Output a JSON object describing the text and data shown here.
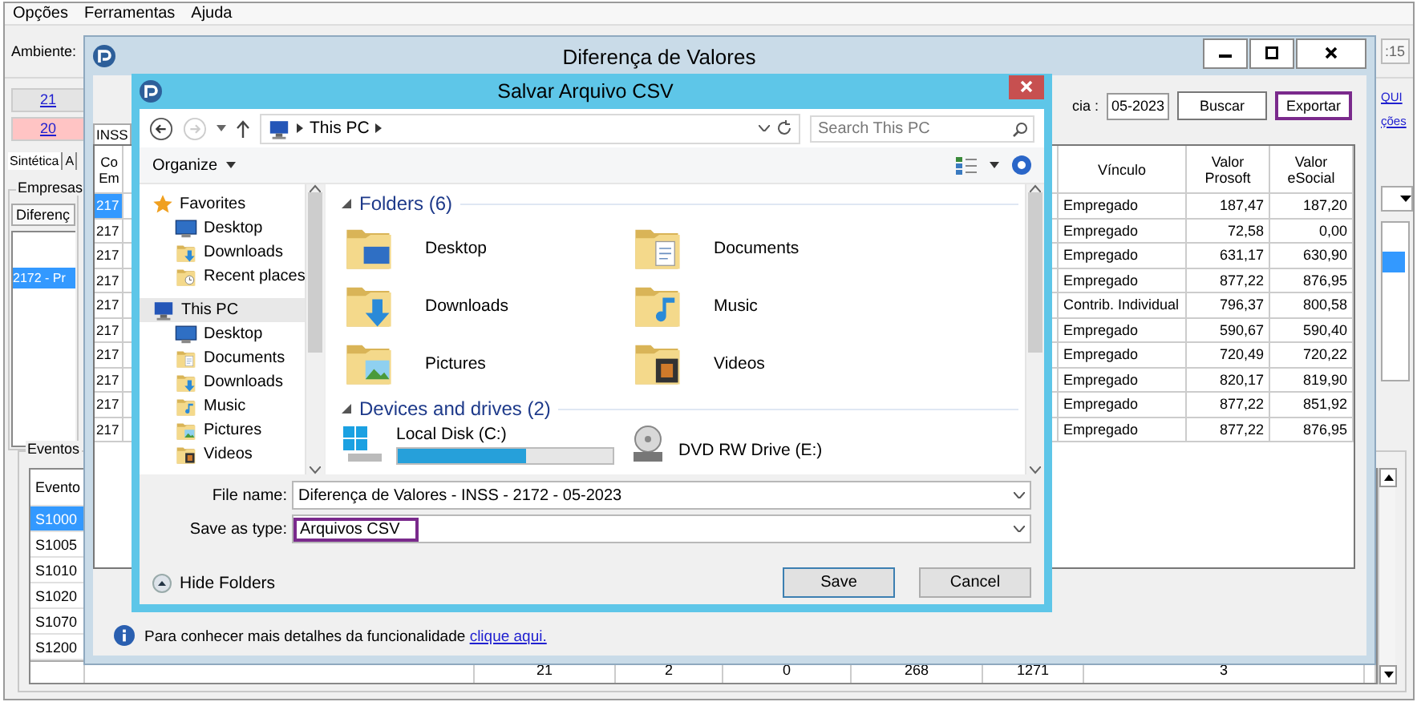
{
  "menu": [
    {
      "label": "Opções"
    },
    {
      "label": "Ferramentas"
    },
    {
      "label": "Ajuda"
    }
  ],
  "main": {
    "environment_label": "Ambiente:",
    "clock_fragment": ":15",
    "counters": [
      {
        "text": "21",
        "color": "#e4e4e4"
      },
      {
        "text": "20",
        "color": "#ffc4c4"
      }
    ],
    "links": [
      "QUI",
      "ções"
    ],
    "tabs": [
      {
        "label": "Sintética",
        "selected": true
      },
      {
        "label": "A",
        "selected": false
      }
    ],
    "companies": {
      "title": "Empresas",
      "dropdown": "Diferenç",
      "items": [
        {
          "label": "2172 - Pr",
          "selected": true
        }
      ]
    },
    "events": {
      "title": "Eventos",
      "header": "Evento",
      "rows": [
        {
          "code": "S1000",
          "selected": true
        },
        {
          "code": "S1005",
          "selected": false
        },
        {
          "code": "S1010",
          "selected": false
        },
        {
          "code": "S1020",
          "selected": false
        },
        {
          "code": "S1070",
          "selected": false
        },
        {
          "code": "S1200",
          "selected": false
        }
      ],
      "totals": [
        "21",
        "2",
        "0",
        "268",
        "1271",
        "3"
      ]
    }
  },
  "diff_window": {
    "title": "Diferença de Valores",
    "period_label": "cia :",
    "period": "05-2023",
    "buttons": [
      {
        "label": "Buscar",
        "highlighted": false
      },
      {
        "label": "Exportar",
        "highlighted": true
      }
    ],
    "tab": "INSS",
    "columns": [
      "Co\nEm",
      "Vínculo",
      "Valor\nProsoft",
      "Valor\neSocial"
    ],
    "rows": [
      {
        "code": "217",
        "link": "Empregado",
        "prosoft": "187,47",
        "esocial": "187,20",
        "selected": true
      },
      {
        "code": "217",
        "link": "Empregado",
        "prosoft": "72,58",
        "esocial": "0,00",
        "selected": false
      },
      {
        "code": "217",
        "link": "Empregado",
        "prosoft": "631,17",
        "esocial": "630,90",
        "selected": false
      },
      {
        "code": "217",
        "link": "Empregado",
        "prosoft": "877,22",
        "esocial": "876,95",
        "selected": false
      },
      {
        "code": "217",
        "link": "Contrib. Individual",
        "prosoft": "796,37",
        "esocial": "800,58",
        "selected": false
      },
      {
        "code": "217",
        "link": "Empregado",
        "prosoft": "590,67",
        "esocial": "590,40",
        "selected": false
      },
      {
        "code": "217",
        "link": "Empregado",
        "prosoft": "720,49",
        "esocial": "720,22",
        "selected": false
      },
      {
        "code": "217",
        "link": "Empregado",
        "prosoft": "820,17",
        "esocial": "819,90",
        "selected": false
      },
      {
        "code": "217",
        "link": "Empregado",
        "prosoft": "877,22",
        "esocial": "851,92",
        "selected": false
      },
      {
        "code": "217",
        "link": "Empregado",
        "prosoft": "877,22",
        "esocial": "876,95",
        "selected": false
      }
    ],
    "info_text": "Para conhecer mais detalhes da funcionalidade",
    "info_link": "clique aqui."
  },
  "save_dialog": {
    "title": "Salvar Arquivo CSV",
    "address": "This PC",
    "search_placeholder": "Search This PC",
    "organize": "Organize",
    "nav": [
      {
        "label": "Favorites",
        "kind": "favorites",
        "selected": false,
        "children": [
          {
            "label": "Desktop",
            "kind": "desktop",
            "selected": false
          },
          {
            "label": "Downloads",
            "kind": "downloads",
            "selected": false
          },
          {
            "label": "Recent places",
            "kind": "recent",
            "selected": false
          }
        ]
      },
      {
        "label": "This PC",
        "kind": "pc",
        "selected": true,
        "children": [
          {
            "label": "Desktop",
            "kind": "desktop",
            "selected": false
          },
          {
            "label": "Documents",
            "kind": "documents",
            "selected": false
          },
          {
            "label": "Downloads",
            "kind": "downloads",
            "selected": false
          },
          {
            "label": "Music",
            "kind": "music",
            "selected": false
          },
          {
            "label": "Pictures",
            "kind": "pictures",
            "selected": false
          },
          {
            "label": "Videos",
            "kind": "videos",
            "selected": false
          }
        ]
      }
    ],
    "sections": [
      {
        "title": "Folders (6)",
        "items": [
          {
            "label": "Desktop",
            "kind": "desktop"
          },
          {
            "label": "Documents",
            "kind": "documents"
          },
          {
            "label": "Downloads",
            "kind": "downloads"
          },
          {
            "label": "Music",
            "kind": "music"
          },
          {
            "label": "Pictures",
            "kind": "pictures"
          },
          {
            "label": "Videos",
            "kind": "videos"
          }
        ]
      },
      {
        "title": "Devices and drives (2)",
        "items": [
          {
            "label": "Local Disk (C:)",
            "kind": "disk",
            "level": 0.6
          },
          {
            "label": "DVD RW Drive (E:)",
            "kind": "dvd"
          }
        ]
      }
    ],
    "file_name_label": "File name:",
    "file_name": "Diferença de Valores - INSS - 2172 - 05-2023",
    "type_label": "Save as type:",
    "type": "Arquivos CSV",
    "type_highlighted": true,
    "hide_folders": "Hide Folders",
    "buttons": [
      "Save",
      "Cancel"
    ]
  }
}
